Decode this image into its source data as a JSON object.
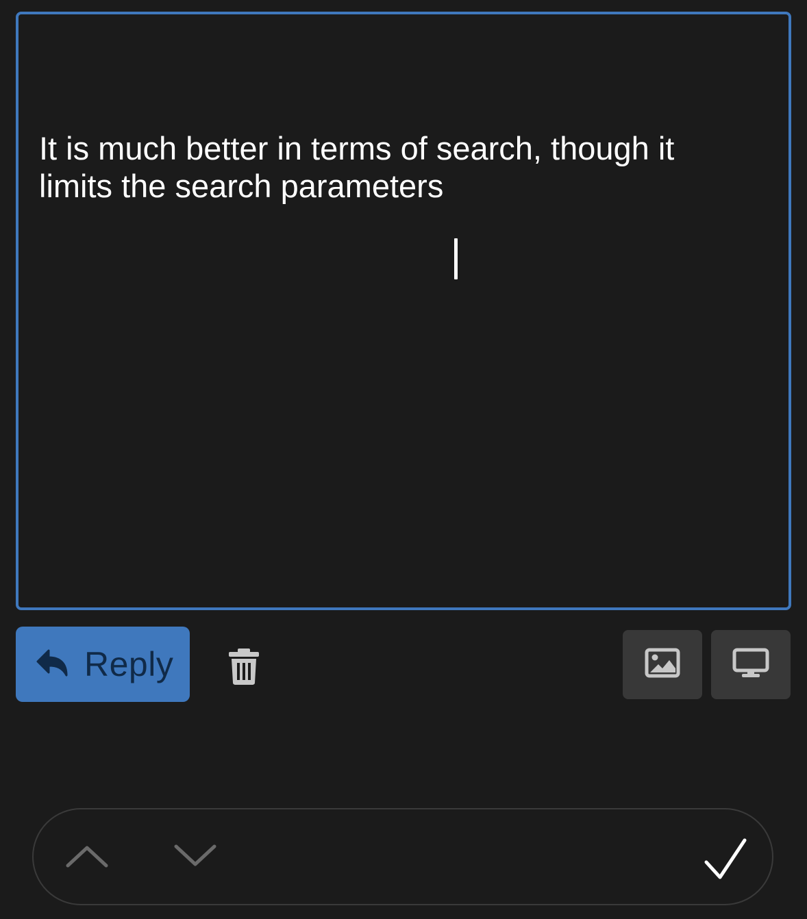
{
  "editor": {
    "text": "It is much better in terms of search, though it\nlimits the search parameters"
  },
  "actions": {
    "reply_label": "Reply",
    "reply_icon": "reply-arrow-icon",
    "delete_icon": "trash-icon",
    "image_icon": "image-icon",
    "screen_icon": "monitor-icon"
  },
  "bottom_bar": {
    "up_icon": "chevron-up-icon",
    "down_icon": "chevron-down-icon",
    "confirm_icon": "checkmark-icon"
  },
  "colors": {
    "background": "#1b1b1b",
    "accent": "#3f78bd",
    "button_dark": "#383838",
    "icon_gray": "#c8c8c8"
  }
}
